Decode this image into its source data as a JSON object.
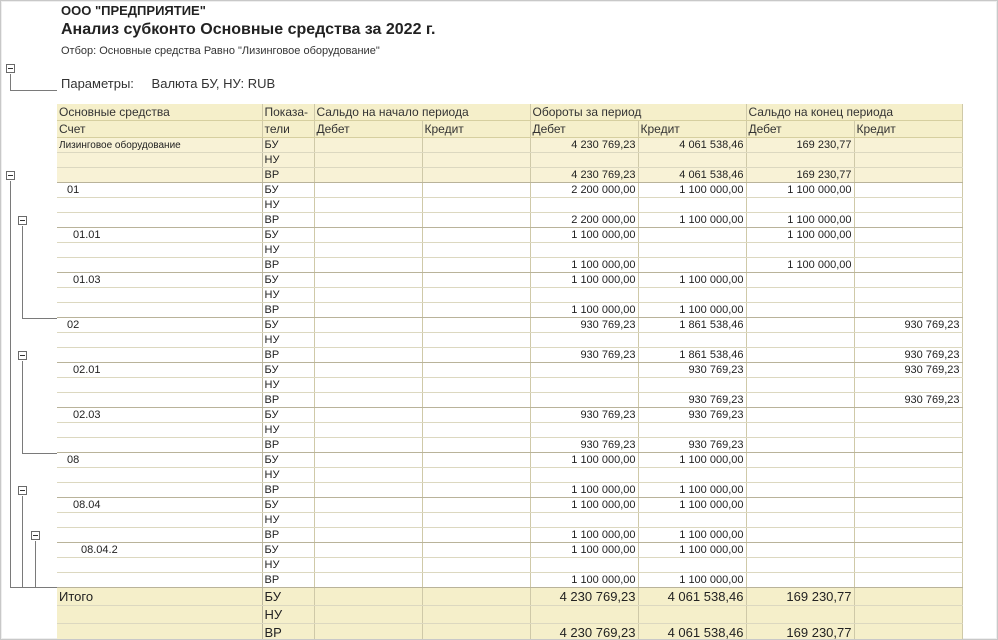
{
  "report": {
    "org": "ООО \"ПРЕДПРИЯТИЕ\"",
    "title": "Анализ субконто Основные средства за 2022 г.",
    "filter": "Отбор: Основные средства Равно \"Лизинговое оборудование\"",
    "params_label": "Параметры:",
    "params_value": "Валюта БУ, НУ: RUB"
  },
  "header": {
    "row1": [
      "Основные средства",
      "Показа-",
      "Сальдо на начало периода",
      "Обороты за период",
      "Сальдо на конец периода"
    ],
    "row2": [
      "Счет",
      "тели",
      "Дебет",
      "Кредит",
      "Дебет",
      "Кредит",
      "Дебет",
      "Кредит"
    ]
  },
  "rows": [
    {
      "name": "Лизинговое оборудование",
      "ind": "БУ",
      "v": [
        "",
        "",
        "4 230 769,23",
        "4 061 538,46",
        "169 230,77",
        ""
      ]
    },
    {
      "name": "",
      "ind": "НУ",
      "v": [
        "",
        "",
        "",
        "",
        "",
        ""
      ]
    },
    {
      "name": "",
      "ind": "ВР",
      "v": [
        "",
        "",
        "4 230 769,23",
        "4 061 538,46",
        "169 230,77",
        ""
      ]
    },
    {
      "name": "01",
      "ind": "БУ",
      "v": [
        "",
        "",
        "2 200 000,00",
        "1 100 000,00",
        "1 100 000,00",
        ""
      ]
    },
    {
      "name": "",
      "ind": "НУ",
      "v": [
        "",
        "",
        "",
        "",
        "",
        ""
      ]
    },
    {
      "name": "",
      "ind": "ВР",
      "v": [
        "",
        "",
        "2 200 000,00",
        "1 100 000,00",
        "1 100 000,00",
        ""
      ]
    },
    {
      "name": "01.01",
      "ind": "БУ",
      "v": [
        "",
        "",
        "1 100 000,00",
        "",
        "1 100 000,00",
        ""
      ]
    },
    {
      "name": "",
      "ind": "НУ",
      "v": [
        "",
        "",
        "",
        "",
        "",
        ""
      ]
    },
    {
      "name": "",
      "ind": "ВР",
      "v": [
        "",
        "",
        "1 100 000,00",
        "",
        "1 100 000,00",
        ""
      ]
    },
    {
      "name": "01.03",
      "ind": "БУ",
      "v": [
        "",
        "",
        "1 100 000,00",
        "1 100 000,00",
        "",
        ""
      ]
    },
    {
      "name": "",
      "ind": "НУ",
      "v": [
        "",
        "",
        "",
        "",
        "",
        ""
      ]
    },
    {
      "name": "",
      "ind": "ВР",
      "v": [
        "",
        "",
        "1 100 000,00",
        "1 100 000,00",
        "",
        ""
      ]
    },
    {
      "name": "02",
      "ind": "БУ",
      "v": [
        "",
        "",
        "930 769,23",
        "1 861 538,46",
        "",
        "930 769,23"
      ]
    },
    {
      "name": "",
      "ind": "НУ",
      "v": [
        "",
        "",
        "",
        "",
        "",
        ""
      ]
    },
    {
      "name": "",
      "ind": "ВР",
      "v": [
        "",
        "",
        "930 769,23",
        "1 861 538,46",
        "",
        "930 769,23"
      ]
    },
    {
      "name": "02.01",
      "ind": "БУ",
      "v": [
        "",
        "",
        "",
        "930 769,23",
        "",
        "930 769,23"
      ]
    },
    {
      "name": "",
      "ind": "НУ",
      "v": [
        "",
        "",
        "",
        "",
        "",
        ""
      ]
    },
    {
      "name": "",
      "ind": "ВР",
      "v": [
        "",
        "",
        "",
        "930 769,23",
        "",
        "930 769,23"
      ]
    },
    {
      "name": "02.03",
      "ind": "БУ",
      "v": [
        "",
        "",
        "930 769,23",
        "930 769,23",
        "",
        ""
      ]
    },
    {
      "name": "",
      "ind": "НУ",
      "v": [
        "",
        "",
        "",
        "",
        "",
        ""
      ]
    },
    {
      "name": "",
      "ind": "ВР",
      "v": [
        "",
        "",
        "930 769,23",
        "930 769,23",
        "",
        ""
      ]
    },
    {
      "name": "08",
      "ind": "БУ",
      "v": [
        "",
        "",
        "1 100 000,00",
        "1 100 000,00",
        "",
        ""
      ]
    },
    {
      "name": "",
      "ind": "НУ",
      "v": [
        "",
        "",
        "",
        "",
        "",
        ""
      ]
    },
    {
      "name": "",
      "ind": "ВР",
      "v": [
        "",
        "",
        "1 100 000,00",
        "1 100 000,00",
        "",
        ""
      ]
    },
    {
      "name": "08.04",
      "ind": "БУ",
      "v": [
        "",
        "",
        "1 100 000,00",
        "1 100 000,00",
        "",
        ""
      ]
    },
    {
      "name": "",
      "ind": "НУ",
      "v": [
        "",
        "",
        "",
        "",
        "",
        ""
      ]
    },
    {
      "name": "",
      "ind": "ВР",
      "v": [
        "",
        "",
        "1 100 000,00",
        "1 100 000,00",
        "",
        ""
      ]
    },
    {
      "name": "08.04.2",
      "ind": "БУ",
      "v": [
        "",
        "",
        "1 100 000,00",
        "1 100 000,00",
        "",
        ""
      ]
    },
    {
      "name": "",
      "ind": "НУ",
      "v": [
        "",
        "",
        "",
        "",
        "",
        ""
      ]
    },
    {
      "name": "",
      "ind": "ВР",
      "v": [
        "",
        "",
        "1 100 000,00",
        "1 100 000,00",
        "",
        ""
      ]
    }
  ],
  "total": [
    {
      "name": "Итого",
      "ind": "БУ",
      "v": [
        "",
        "",
        "4 230 769,23",
        "4 061 538,46",
        "169 230,77",
        ""
      ]
    },
    {
      "name": "",
      "ind": "НУ",
      "v": [
        "",
        "",
        "",
        "",
        "",
        ""
      ]
    },
    {
      "name": "",
      "ind": "ВР",
      "v": [
        "",
        "",
        "4 230 769,23",
        "4 061 538,46",
        "169 230,77",
        ""
      ]
    }
  ],
  "tree_icons": [
    "collapse-icon",
    "collapse-icon",
    "collapse-icon",
    "collapse-icon",
    "collapse-icon",
    "collapse-icon"
  ]
}
